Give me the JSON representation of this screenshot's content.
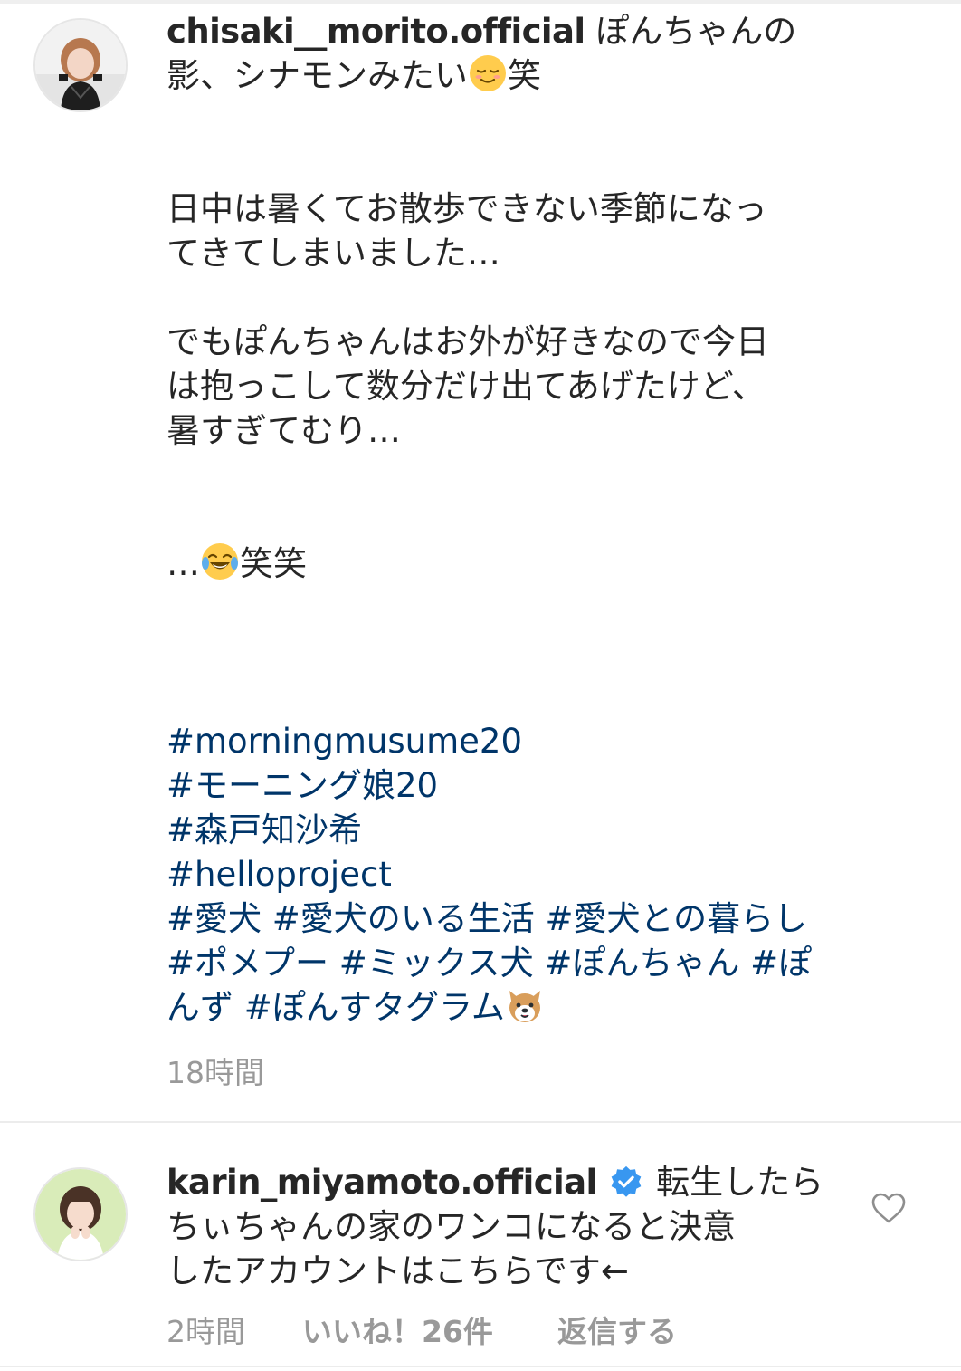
{
  "post": {
    "username": "chisaki__morito.official",
    "caption_first": "ぽんちゃんの影、シナモンみたい",
    "caption_first_emoji": "relieved-face-emoji",
    "caption_first_after": "笑",
    "paragraph_1_line_1": "日中は暑くてお散歩できない季節になっ",
    "paragraph_1_line_2": "てきてしまいました…",
    "paragraph_2_line_1": "でもぽんちゃんはお外が好きなので今日",
    "paragraph_2_line_2": "は抱っこして数分だけ出てあげたけど、",
    "paragraph_2_line_3": "暑すぎてむり…",
    "laugh_before": "…",
    "laugh_emoji": "face-with-tears-of-joy-emoji",
    "laugh_after": "笑笑",
    "hashtags": {
      "line_1": "#morningmusume20",
      "line_2": "#モーニング娘20",
      "line_3": "#森戸知沙希",
      "line_4": "#helloproject",
      "line_5": "#愛犬 #愛犬のいる生活 #愛犬との暮らし",
      "line_6": "#ポメプー #ミックス犬 #ぽんちゃん #ぽ",
      "line_7": "んず #ぽんすタグラム",
      "trailing_emoji": "dog-face-emoji"
    },
    "timestamp": "18時間"
  },
  "comment": {
    "username": "karin_miyamoto.official",
    "verified_icon": "verified-badge-icon",
    "text_line_1": "転生したら",
    "text_line_2": "ちぃちゃんの家のワンコになると決意",
    "text_line_3": "したアカウントはこちらです←",
    "time": "2時間",
    "likes": "いいね！26件",
    "reply": "返信する",
    "like_icon": "heart-outline-icon"
  },
  "colors": {
    "text": "#262626",
    "hashtag": "#003569",
    "muted": "#999999",
    "verified": "#3897f0",
    "divider": "#ececec"
  }
}
